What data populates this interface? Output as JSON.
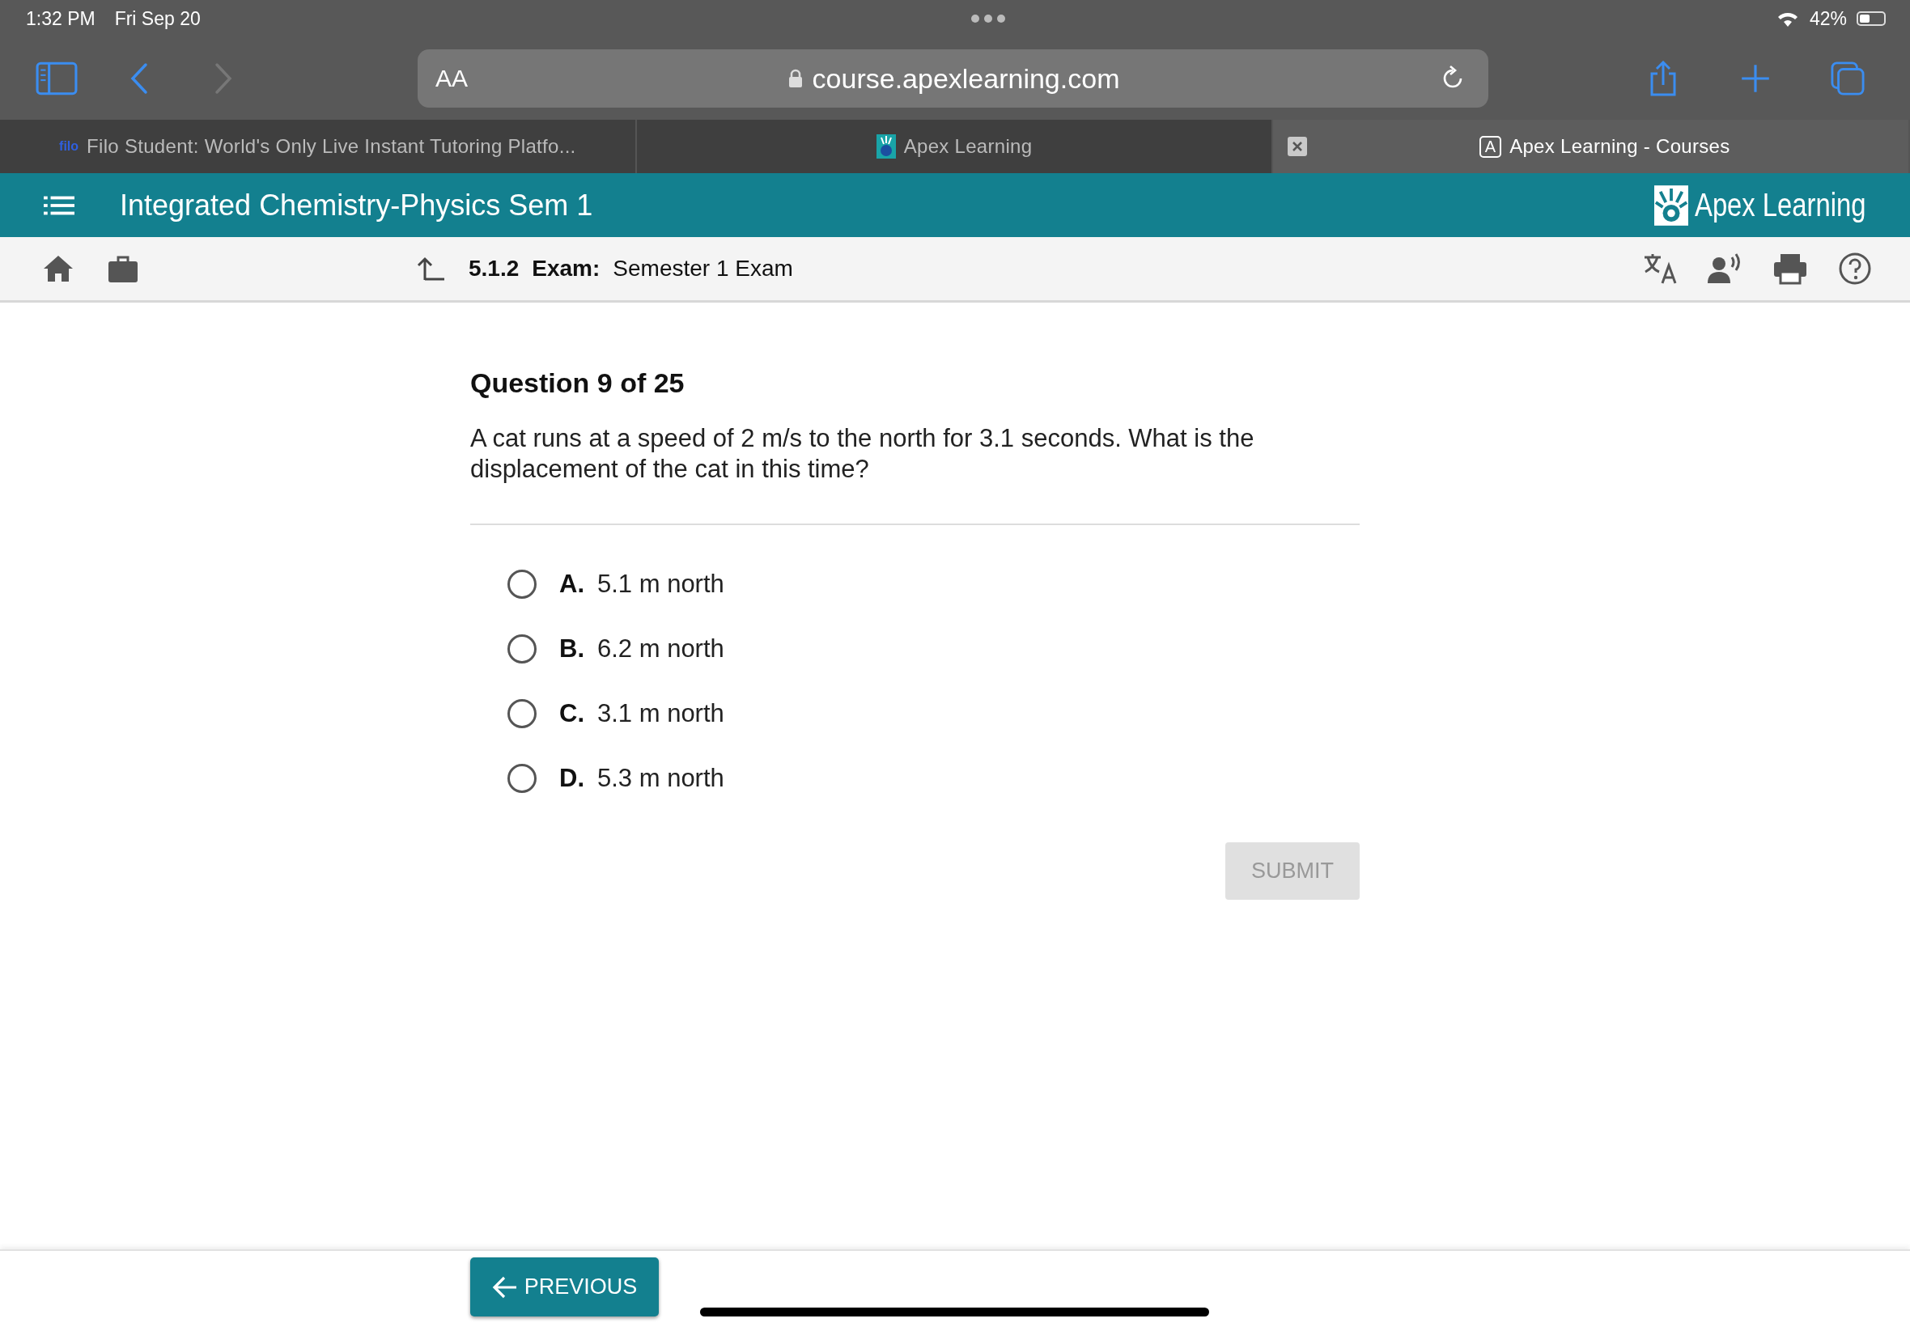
{
  "status_bar": {
    "time": "1:32 PM",
    "date": "Fri Sep 20",
    "battery": "42%"
  },
  "browser": {
    "text_size_button": "AA",
    "url": "course.apexlearning.com"
  },
  "tabs": [
    {
      "title": "Filo Student: World's Only Live Instant Tutoring Platfo...",
      "favicon_text": "filo",
      "selected": false
    },
    {
      "title": "Apex Learning",
      "selected": false
    },
    {
      "title": "Apex Learning - Courses",
      "favicon_text": "A",
      "selected": true
    }
  ],
  "course_header": {
    "title": "Integrated Chemistry-Physics Sem 1",
    "logo": "Apex Learning"
  },
  "breadcrumb": {
    "number": "5.1.2",
    "type": "Exam:",
    "title": "Semester 1 Exam"
  },
  "question": {
    "heading": "Question 9 of 25",
    "text": "A cat runs at a speed of 2 m/s to the north for 3.1 seconds. What is the displacement of the cat in this time?",
    "options": [
      {
        "letter": "A.",
        "text": "5.1 m north",
        "selected": false
      },
      {
        "letter": "B.",
        "text": "6.2 m north",
        "selected": false
      },
      {
        "letter": "C.",
        "text": "3.1 m north",
        "selected": false
      },
      {
        "letter": "D.",
        "text": "5.3 m north",
        "selected": false
      }
    ]
  },
  "submit": {
    "label": "SUBMIT",
    "disabled": true
  },
  "previous": {
    "label": "PREVIOUS"
  }
}
